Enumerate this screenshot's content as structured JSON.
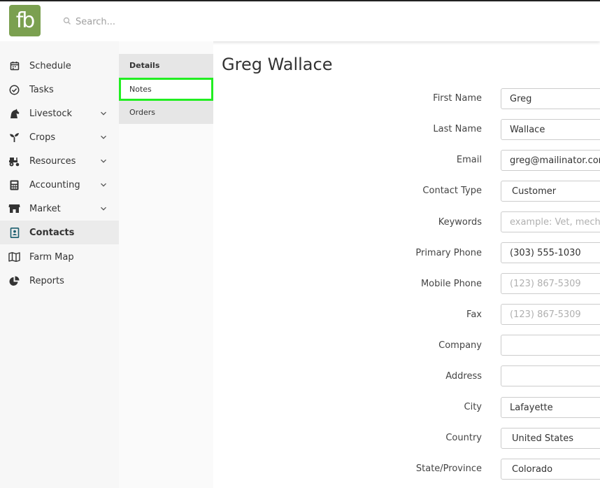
{
  "app": {
    "logo_text": "fb"
  },
  "search": {
    "placeholder": "Search..."
  },
  "sidebar": {
    "items": [
      {
        "label": "Schedule",
        "icon": "calendar-icon",
        "expandable": false
      },
      {
        "label": "Tasks",
        "icon": "check-circle-icon",
        "expandable": false
      },
      {
        "label": "Livestock",
        "icon": "horse-icon",
        "expandable": true
      },
      {
        "label": "Crops",
        "icon": "seedling-icon",
        "expandable": true
      },
      {
        "label": "Resources",
        "icon": "tractor-icon",
        "expandable": true
      },
      {
        "label": "Accounting",
        "icon": "calculator-icon",
        "expandable": true
      },
      {
        "label": "Market",
        "icon": "store-icon",
        "expandable": true
      },
      {
        "label": "Contacts",
        "icon": "address-book-icon",
        "expandable": false,
        "active": true
      },
      {
        "label": "Farm Map",
        "icon": "map-icon",
        "expandable": false
      },
      {
        "label": "Reports",
        "icon": "pie-chart-icon",
        "expandable": false
      }
    ]
  },
  "subnav": {
    "items": [
      {
        "label": "Details"
      },
      {
        "label": "Notes"
      },
      {
        "label": "Orders"
      }
    ]
  },
  "contact": {
    "title": "Greg Wallace",
    "fields": {
      "first_name": {
        "label": "First Name",
        "value": "Greg"
      },
      "last_name": {
        "label": "Last Name",
        "value": "Wallace"
      },
      "email": {
        "label": "Email",
        "value": "greg@mailinator.com"
      },
      "contact_type": {
        "label": "Contact Type",
        "value": "Customer"
      },
      "keywords": {
        "label": "Keywords",
        "placeholder": "example: Vet, mechanic"
      },
      "primary_phone": {
        "label": "Primary Phone",
        "value": "(303) 555-1030"
      },
      "mobile_phone": {
        "label": "Mobile Phone",
        "placeholder": "(123) 867-5309"
      },
      "fax": {
        "label": "Fax",
        "placeholder": "(123) 867-5309"
      },
      "company": {
        "label": "Company",
        "value": ""
      },
      "address": {
        "label": "Address",
        "value": ""
      },
      "city": {
        "label": "City",
        "value": "Lafayette"
      },
      "country": {
        "label": "Country",
        "value": "United States"
      },
      "state": {
        "label": "State/Province",
        "value": "Colorado"
      }
    }
  },
  "colors": {
    "brand": "#7ba050",
    "highlight": "#22ee22"
  }
}
